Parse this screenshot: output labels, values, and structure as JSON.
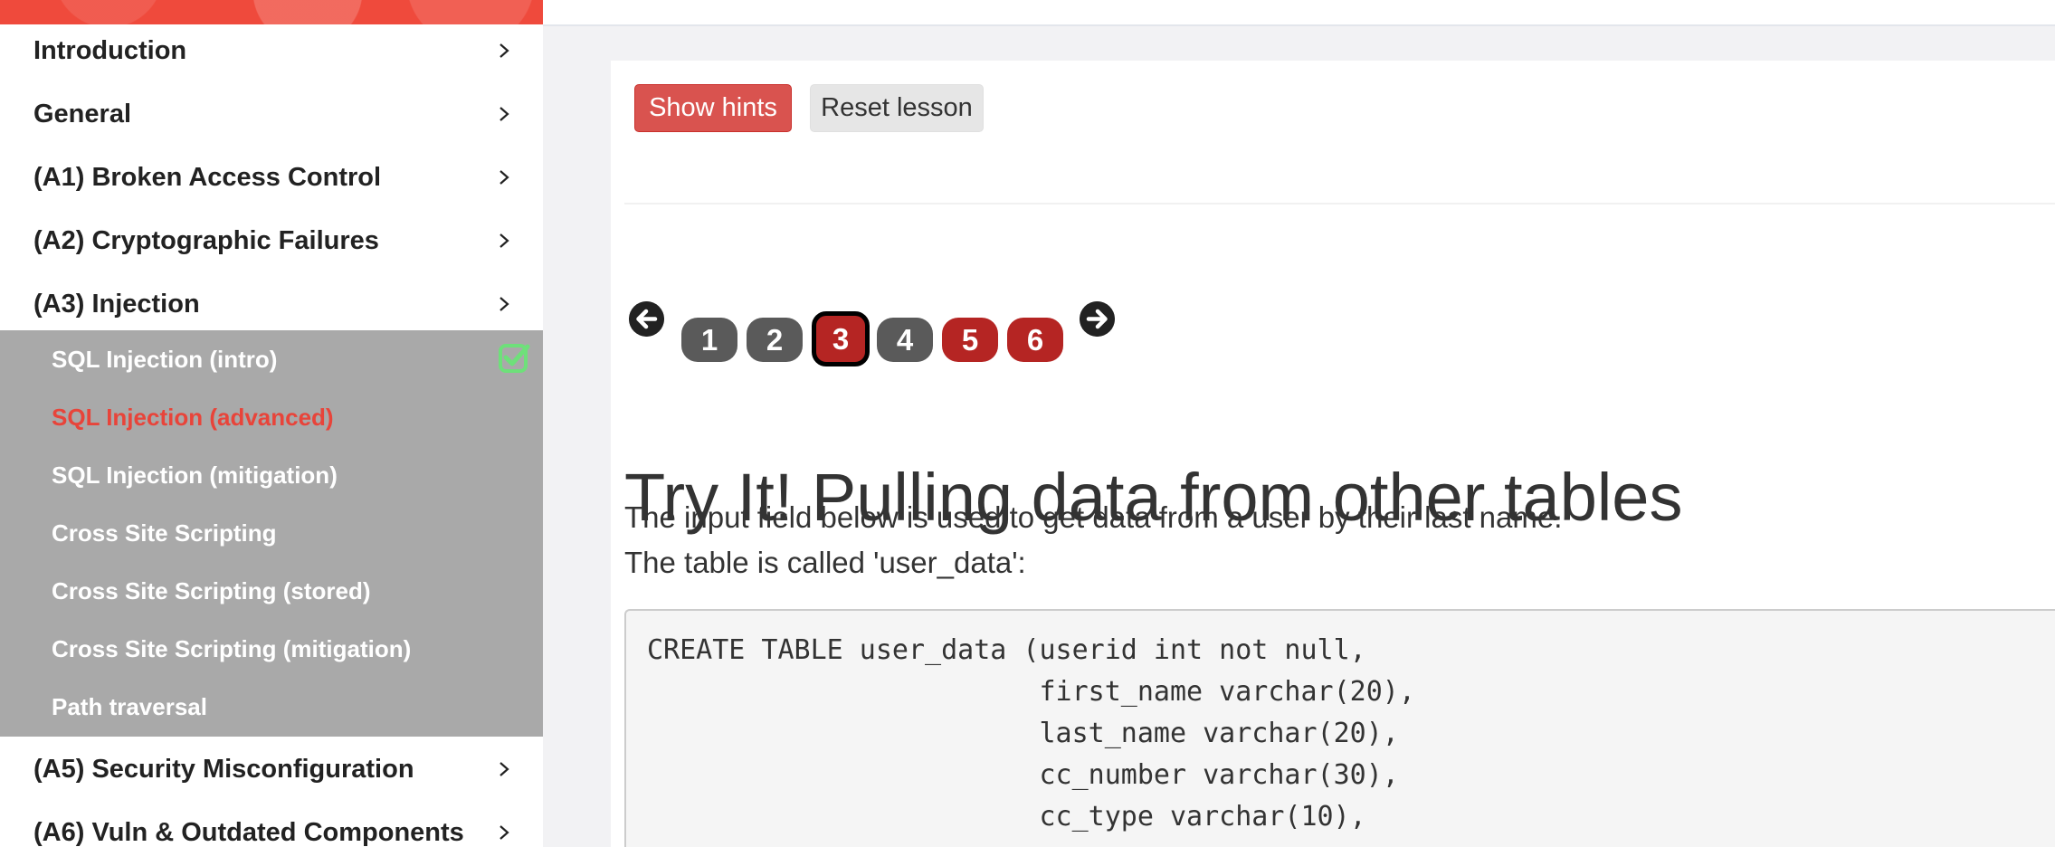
{
  "sidebar": {
    "categories_top": [
      {
        "label": "Introduction"
      },
      {
        "label": "General"
      },
      {
        "label": "(A1) Broken Access Control"
      },
      {
        "label": "(A2) Cryptographic Failures"
      },
      {
        "label": "(A3) Injection"
      }
    ],
    "lessons": [
      {
        "label": "SQL Injection (intro)",
        "completed": true
      },
      {
        "label": "SQL Injection (advanced)",
        "active": true
      },
      {
        "label": "SQL Injection (mitigation)"
      },
      {
        "label": "Cross Site Scripting"
      },
      {
        "label": "Cross Site Scripting (stored)"
      },
      {
        "label": "Cross Site Scripting (mitigation)"
      },
      {
        "label": "Path traversal"
      }
    ],
    "categories_bottom": [
      {
        "label": "(A5) Security Misconfiguration"
      },
      {
        "label": "(A6) Vuln & Outdated Components"
      }
    ]
  },
  "toolbar": {
    "show_hints_label": "Show hints",
    "reset_lesson_label": "Reset lesson"
  },
  "pagination": {
    "prev_icon": "arrow-left-icon",
    "next_icon": "arrow-right-icon",
    "pages": [
      {
        "label": "1",
        "status": "grey"
      },
      {
        "label": "2",
        "status": "grey"
      },
      {
        "label": "3",
        "status": "current"
      },
      {
        "label": "4",
        "status": "grey"
      },
      {
        "label": "5",
        "status": "red"
      },
      {
        "label": "6",
        "status": "red"
      }
    ]
  },
  "lesson": {
    "title": "Try It! Pulling data from other tables",
    "paragraph_1": "The input field below is used to get data from a user by their last name.",
    "paragraph_2": "The table is called 'user_data':",
    "code_lines": [
      "CREATE TABLE user_data (userid int not null,",
      "                        first_name varchar(20),",
      "                        last_name varchar(20),",
      "                        cc_number varchar(30),",
      "                        cc_type varchar(10),"
    ]
  },
  "colors": {
    "brand": "#ef4a3c",
    "active_lesson": "#e8443a",
    "hint_button": "#d9534f",
    "page_incomplete": "#b52523",
    "page_complete": "#5a5a5a",
    "completed_check": "#6ee07a"
  }
}
